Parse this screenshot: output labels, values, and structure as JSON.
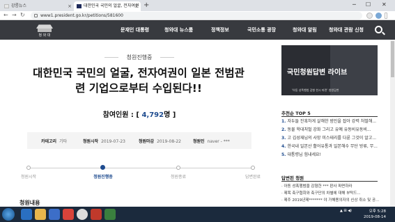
{
  "browser": {
    "tabs": [
      {
        "label": "강릉뉴스"
      },
      {
        "label": "대한민국 국민의 얼굴, 전자여권"
      }
    ],
    "url": "www1.president.go.kr/petitions/581600",
    "new_tab_symbol": "+",
    "window_controls": {
      "minimize": "─",
      "maximize": "☐",
      "close": "✕"
    }
  },
  "site": {
    "logo_text": "청 와 대",
    "menu": [
      "문재인 대통령",
      "청와대 뉴스룸",
      "정책정보",
      "국민소통 광장",
      "청와대 알림",
      "청와대 관람 신청"
    ]
  },
  "petition": {
    "status": "청원진행중",
    "title_line1": "대한민국 국민의 얼굴, 전자여권이 일본 전범관",
    "title_line2": "련 기업으로부터 수입된다!!",
    "participants_label": "참여인원 : [ ",
    "participants_count": "4,792",
    "participants_suffix": "명 ]",
    "info": {
      "category_label": "카테고리",
      "category_value": "기타",
      "start_label": "청원시작",
      "start_value": "2019-07-23",
      "end_label": "청원마감",
      "end_value": "2019-08-22",
      "author_label": "청원인",
      "author_value": "naver - ***"
    },
    "steps": [
      "청원시작",
      "청원진행중",
      "청원종료",
      "답변완료"
    ],
    "active_step": 1,
    "content_heading": "청원내용"
  },
  "sidebar": {
    "banner_headline": "국민청원답변 라이브",
    "banner_sub": "'아동 성폭행범 감형 한시 파면' 청원답변",
    "recommend_title": "추천순 TOP 5",
    "recommend": [
      {
        "n": "1.",
        "text": "자두들 잔혹하게 살해한 범인을 잡아 강력 처벌해..."
      },
      {
        "n": "2.",
        "text": "동물 학대처벌 강화 그리고 유예 유동비유동비..."
      },
      {
        "n": "3.",
        "text": "고 김성재님의 사망 미스테리를 다룬 그것이 알고..."
      },
      {
        "n": "4.",
        "text": "한국내 일본산 활어유통과 일본해수 무단 방류, 무..."
      },
      {
        "n": "5.",
        "text": "대통령님 힘내세요!"
      }
    ],
    "answer_title": "답변된 청원",
    "answers": [
      "· 아동 성폭행범을 감형한 *** 판사 파면하라",
      "· 제목 축구협회와 축구단의 차별에 대해 부탁드...",
      "· 제주 2019년제******* 야 가해용의자의 신상 취소 및 공..."
    ]
  },
  "taskbar": {
    "clock_time": "오후 5:28",
    "clock_date": "2019-08-14",
    "tray_text": "▲ ⊞ ◀)"
  }
}
